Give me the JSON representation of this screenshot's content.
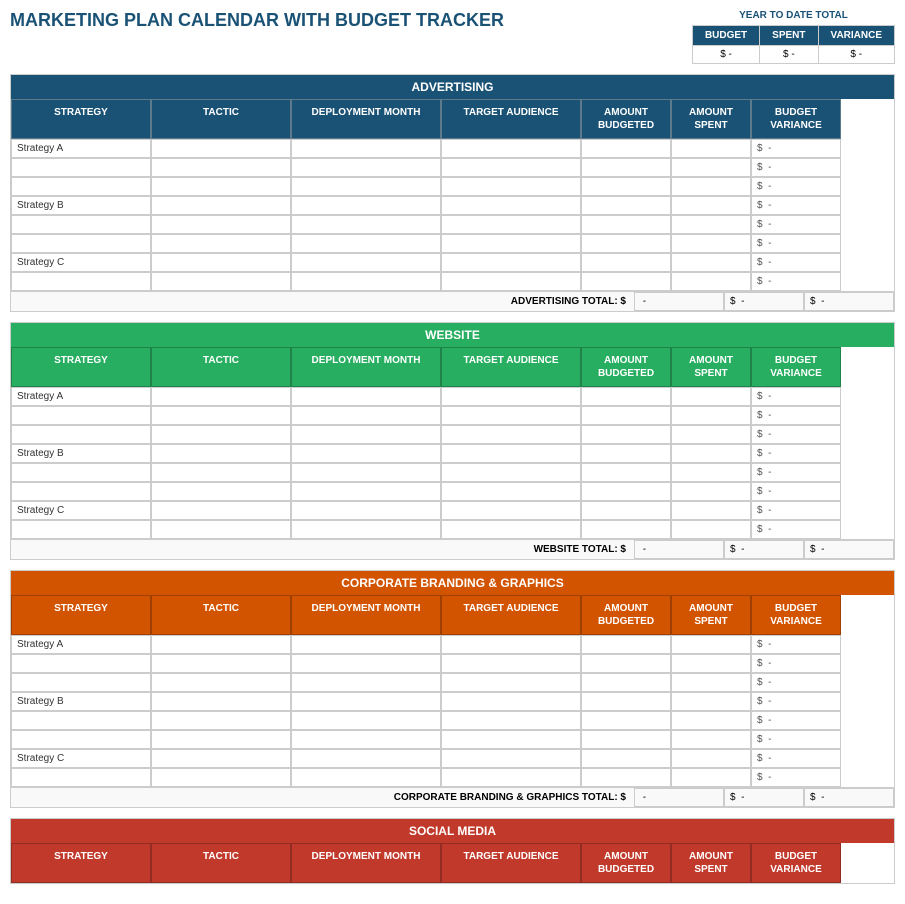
{
  "title": "MARKETING PLAN CALENDAR WITH BUDGET TRACKER",
  "ytd": {
    "label": "YEAR TO DATE TOTAL",
    "columns": [
      "BUDGET",
      "SPENT",
      "VARIANCE"
    ],
    "values": [
      "$ -",
      "$ -",
      "$ -"
    ]
  },
  "sections": [
    {
      "id": "advertising",
      "name": "ADVERTISING",
      "colorClass": "advertising-header",
      "headerColorClass": "",
      "totalLabel": "ADVERTISING TOTAL: $",
      "strategies": [
        "Strategy A",
        "Strategy B",
        "Strategy C"
      ],
      "rowsPerStrategy": 3
    },
    {
      "id": "website",
      "name": "WEBSITE",
      "colorClass": "website-header",
      "headerColorClass": "green",
      "totalLabel": "WEBSITE TOTAL: $",
      "strategies": [
        "Strategy A",
        "Strategy B",
        "Strategy C"
      ],
      "rowsPerStrategy": 3
    },
    {
      "id": "branding",
      "name": "CORPORATE BRANDING & GRAPHICS",
      "colorClass": "branding-header",
      "headerColorClass": "orange",
      "totalLabel": "CORPORATE BRANDING & GRAPHICS TOTAL: $",
      "strategies": [
        "Strategy A",
        "Strategy B",
        "Strategy C"
      ],
      "rowsPerStrategy": 3
    },
    {
      "id": "social",
      "name": "SOCIAL MEDIA",
      "colorClass": "social-header",
      "headerColorClass": "red",
      "totalLabel": "",
      "strategies": [],
      "rowsPerStrategy": 0
    }
  ],
  "columns": {
    "strategy": "STRATEGY",
    "tactic": "TACTIC",
    "deployment": "DEPLOYMENT MONTH",
    "audience": "TARGET AUDIENCE",
    "budgeted": "AMOUNT BUDGETED",
    "spent": "AMOUNT SPENT",
    "variance": "BUDGET VARIANCE"
  }
}
